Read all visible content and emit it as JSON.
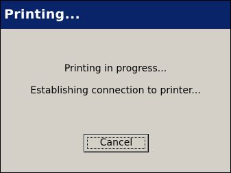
{
  "window": {
    "title": "Printing..."
  },
  "dialog": {
    "status_message": "Printing in progress...",
    "detail_message": "Establishing connection to printer..."
  },
  "buttons": {
    "cancel_label": "Cancel"
  },
  "colors": {
    "titlebar": "#0a246a",
    "title_text": "#ffffff",
    "dialog_face": "#d4d0c8",
    "text": "#000000"
  }
}
